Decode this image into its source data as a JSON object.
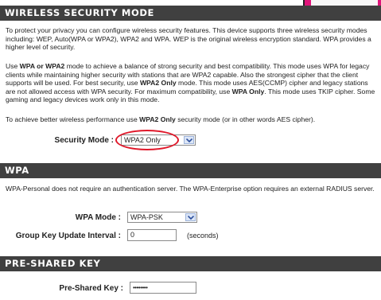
{
  "security_mode_section": {
    "title": "WIRELESS SECURITY MODE",
    "intro": "To protect your privacy you can configure wireless security features. This device supports three wireless security modes including: WEP, Auto(WPA or WPA2), WPA2 and WPA. WEP is the original wireless encryption standard. WPA provides a higher level of security.",
    "para2_parts": [
      "Use ",
      "WPA or WPA2",
      " mode to achieve a balance of strong security and best compatibility. This mode uses WPA for legacy clients while maintaining higher security with stations that are WPA2 capable. Also the strongest cipher that the client supports will be used. For best security, use ",
      "WPA2 Only",
      " mode. This mode uses AES(CCMP) cipher and legacy stations are not allowed access with WPA security. For maximum compatibility, use ",
      "WPA Only",
      ". This mode uses TKIP cipher. Some gaming and legacy devices work only in this mode."
    ],
    "para3_parts": [
      "To achieve better wireless performance use ",
      "WPA2 Only",
      " security mode (or in other words AES cipher)."
    ],
    "security_mode_label": "Security Mode :",
    "security_mode_value": "WPA2 Only"
  },
  "wpa_section": {
    "title": "WPA",
    "description": "WPA-Personal does not require an authentication server. The WPA-Enterprise option requires an external RADIUS server.",
    "wpa_mode_label": "WPA Mode :",
    "wpa_mode_value": "WPA-PSK",
    "group_key_label": "Group Key Update Interval :",
    "group_key_value": "0",
    "group_key_unit": "(seconds)"
  },
  "psk_section": {
    "title": "PRE-SHARED KEY",
    "psk_label": "Pre-Shared Key :",
    "psk_value": "••••••••"
  },
  "colors": {
    "header_bg": "#404040",
    "highlight_circle": "#e0182a",
    "corner_banner": "#e0147a"
  }
}
